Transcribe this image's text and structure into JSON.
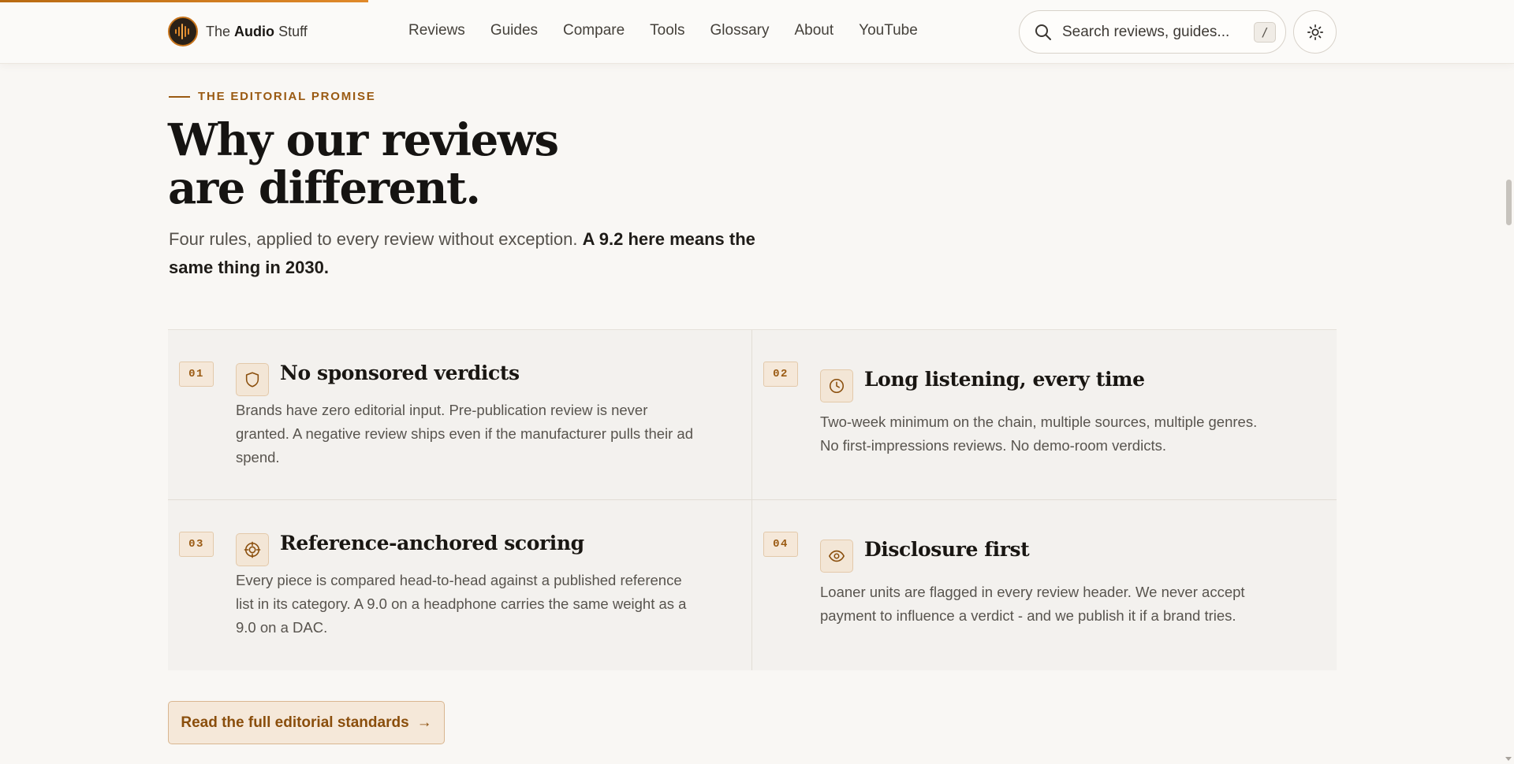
{
  "header": {
    "logo": {
      "prefix": "The",
      "brand": "Audio",
      "suffix": "Stuff"
    },
    "nav": [
      {
        "label": "Reviews",
        "key": "reviews"
      },
      {
        "label": "Guides",
        "key": "guides"
      },
      {
        "label": "Compare",
        "key": "compare"
      },
      {
        "label": "Tools",
        "key": "tools"
      },
      {
        "label": "Glossary",
        "key": "glossary"
      },
      {
        "label": "About",
        "key": "about"
      },
      {
        "label": "YouTube",
        "key": "youtube"
      }
    ],
    "search": {
      "placeholder": "Search reviews, guides...",
      "shortcut": "/"
    },
    "theme_icon": "sun-icon"
  },
  "reading_progress": 0.243,
  "section": {
    "eyebrow": "THE EDITORIAL PROMISE",
    "title_line1": "Why our reviews",
    "title_line2": "are different.",
    "intro": "Four rules, applied to every review without exception.",
    "intro_bold": "A 9.2 here means the same thing in 2030."
  },
  "rules": [
    {
      "number": "01",
      "icon": "shield-icon",
      "title": "No sponsored verdicts",
      "body": "Brands have zero editorial input. Pre-publication review is never granted. A negative review ships even if the manufacturer pulls their ad spend."
    },
    {
      "number": "02",
      "icon": "clock-icon",
      "title": "Long listening, every time",
      "body": "Two-week minimum on the chain, multiple sources, multiple genres. No first-impressions reviews. No demo-room verdicts."
    },
    {
      "number": "03",
      "icon": "target-icon",
      "title": "Reference-anchored scoring",
      "body": "Every piece is compared head-to-head against a published reference list in its category. A 9.0 on a headphone carries the same weight as a 9.0 on a DAC."
    },
    {
      "number": "04",
      "icon": "eye-icon",
      "title": "Disclosure first",
      "body": "Loaner units are flagged in every review header. We never accept payment to influence a verdict - and we publish it if a brand tries."
    }
  ],
  "cta": {
    "label": "Read the full editorial standards",
    "arrow": "→"
  },
  "colors": {
    "accent": "#9a5a12",
    "background": "#f9f7f4",
    "card": "#f3f1ee"
  }
}
